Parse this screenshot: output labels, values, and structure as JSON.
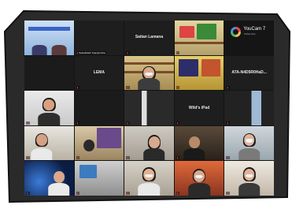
{
  "meeting": {
    "tiles": [
      {
        "label": "",
        "muted": false
      },
      {
        "label": "Suksabiteth Suanprincha",
        "muted": true
      },
      {
        "label": "",
        "muted": true,
        "center": "Saitan Lamana"
      },
      {
        "label": "",
        "muted": true
      },
      {
        "label": "",
        "muted": false,
        "watermark": {
          "brand": "YouCam 7",
          "sub": "Perfect Corp"
        }
      },
      {
        "label": "",
        "muted": false
      },
      {
        "label": "",
        "muted": true,
        "center": "LEMA"
      },
      {
        "label": "",
        "muted": true
      },
      {
        "label": "",
        "muted": true
      },
      {
        "label": "",
        "muted": true,
        "center": "ATA-N4D5R0HaD..."
      },
      {
        "label": "",
        "muted": true
      },
      {
        "label": "",
        "muted": true
      },
      {
        "label": "",
        "muted": true
      },
      {
        "label": "",
        "muted": true,
        "center": "Wild's iPad"
      },
      {
        "label": "",
        "muted": true
      },
      {
        "label": "",
        "muted": true
      },
      {
        "label": "",
        "muted": true
      },
      {
        "label": "",
        "muted": true
      },
      {
        "label": "",
        "muted": true
      },
      {
        "label": "",
        "muted": true
      },
      {
        "label": "",
        "muted": true
      },
      {
        "label": "",
        "muted": true
      },
      {
        "label": "",
        "muted": true
      },
      {
        "label": "",
        "muted": true
      },
      {
        "label": "",
        "muted": true
      }
    ],
    "mic_icon": "mic-muted-icon",
    "accent_color": "#d8d24a"
  }
}
